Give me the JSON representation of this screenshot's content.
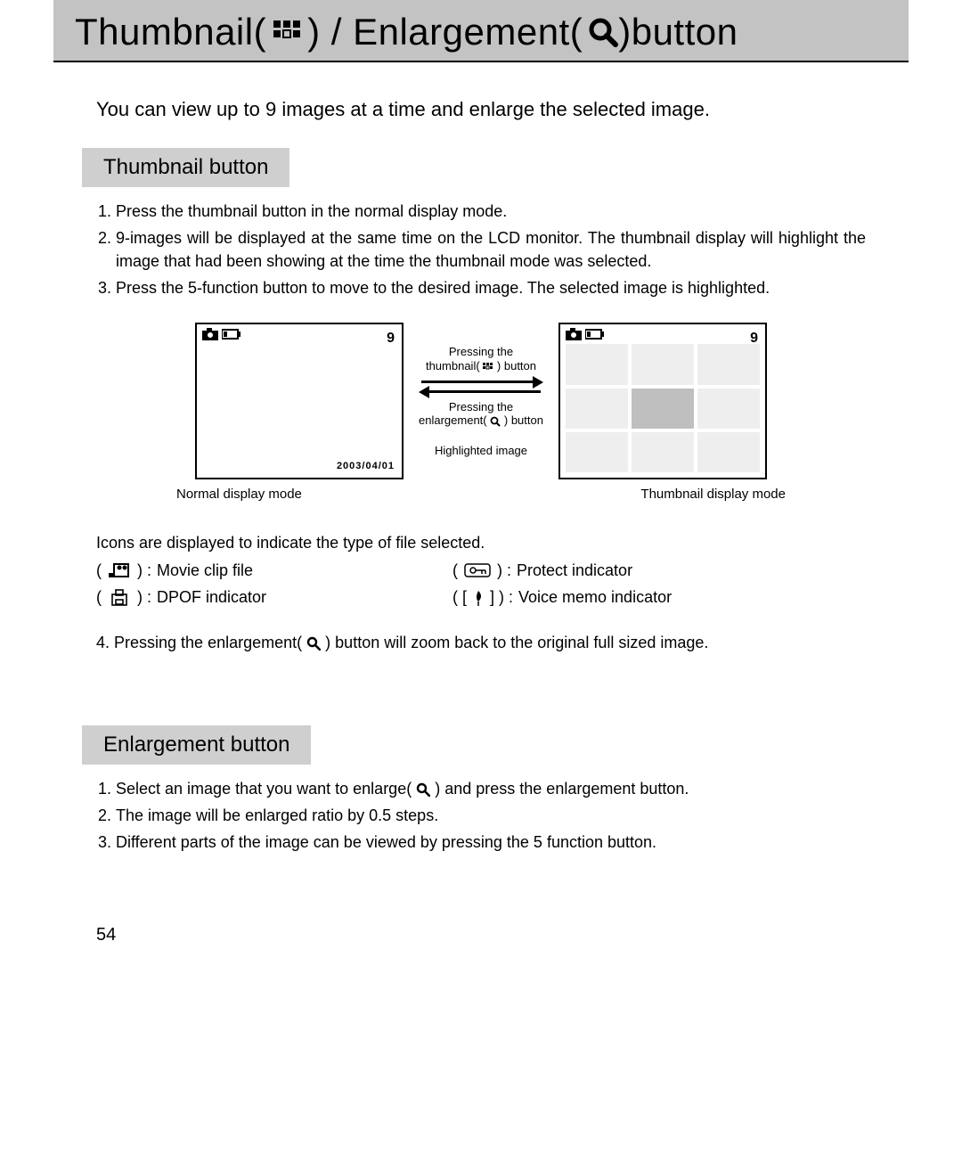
{
  "title": {
    "part1": "Thumbnail(",
    "part2": ") / Enlargement(",
    "part3": ")button"
  },
  "intro": "You can view up to 9 images at a time and enlarge the selected image.",
  "section1": {
    "heading": "Thumbnail button",
    "steps": [
      "Press the thumbnail button in the normal display mode.",
      "9-images will be displayed at the same time on the LCD monitor. The thumbnail display will highlight the image that had been showing at the time the thumbnail mode was selected.",
      "Press the 5-function button to move to the desired image. The selected image is highlighted."
    ],
    "diagram": {
      "left_num": "9",
      "right_num": "9",
      "date": "2003/04/01",
      "mid_top_line1": "Pressing the",
      "mid_top_line2": "thumbnail(",
      "mid_top_line3": ") button",
      "mid_bot_line1": "Pressing the",
      "mid_bot_line2": "enlargement(",
      "mid_bot_line3": ") button",
      "highlighted_label": "Highlighted image",
      "left_caption": "Normal display mode",
      "right_caption": "Thumbnail display mode"
    },
    "legend_intro": "Icons are displayed to indicate the type of file selected.",
    "legend": {
      "movie": "Movie clip file",
      "dpof": "DPOF indicator",
      "protect": "Protect indicator",
      "voice": "Voice memo indicator"
    },
    "step4_pre": "Pressing the enlargement(",
    "step4_post": ") button will zoom back to the original full sized image."
  },
  "section2": {
    "heading": "Enlargement button",
    "steps": [
      "Select an image that you want to enlarge(",
      ") and press the enlargement button.",
      "The image will be enlarged ratio by 0.5 steps.",
      "Different parts of the image can be viewed by pressing the 5 function button."
    ]
  },
  "page_number": "54"
}
